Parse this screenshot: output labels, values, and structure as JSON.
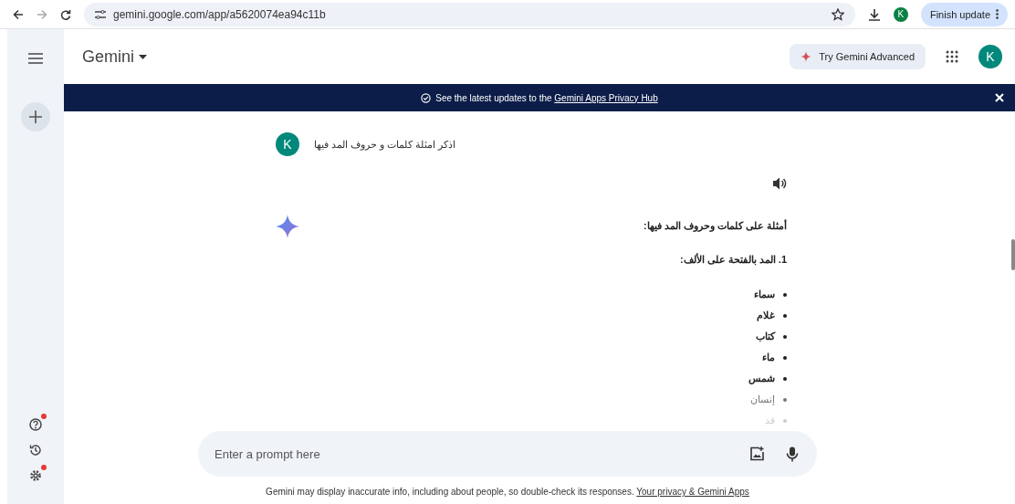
{
  "browser": {
    "url": "gemini.google.com/app/a5620074ea94c11b",
    "avatar": "K",
    "update_button": "Finish update"
  },
  "header": {
    "title": "Gemini",
    "advanced_button": "Try Gemini Advanced",
    "avatar": "K"
  },
  "banner": {
    "text": "See the latest updates to the ",
    "link": "Gemini Apps Privacy Hub"
  },
  "rail": [
    {
      "kind": "help",
      "notification": true
    },
    {
      "kind": "history",
      "notification": false
    },
    {
      "kind": "settings",
      "notification": true
    }
  ],
  "user_message": {
    "avatar": "K",
    "text": "اذكر امثلة كلمات و حروف المد فيها"
  },
  "response": {
    "heading": "أمثلة على كلمات وحروف المد فيها:",
    "section": "1. المد بالفتحة على الألف:",
    "items": [
      "سماء",
      "غلام",
      "كتاب",
      "ماء",
      "شمس",
      "إنسان",
      "قد"
    ]
  },
  "prompt": {
    "placeholder": "Enter a prompt here"
  },
  "footer": {
    "text": "Gemini may display inaccurate info, including about people, so double-check its responses. ",
    "link": "Your privacy & Gemini Apps"
  }
}
